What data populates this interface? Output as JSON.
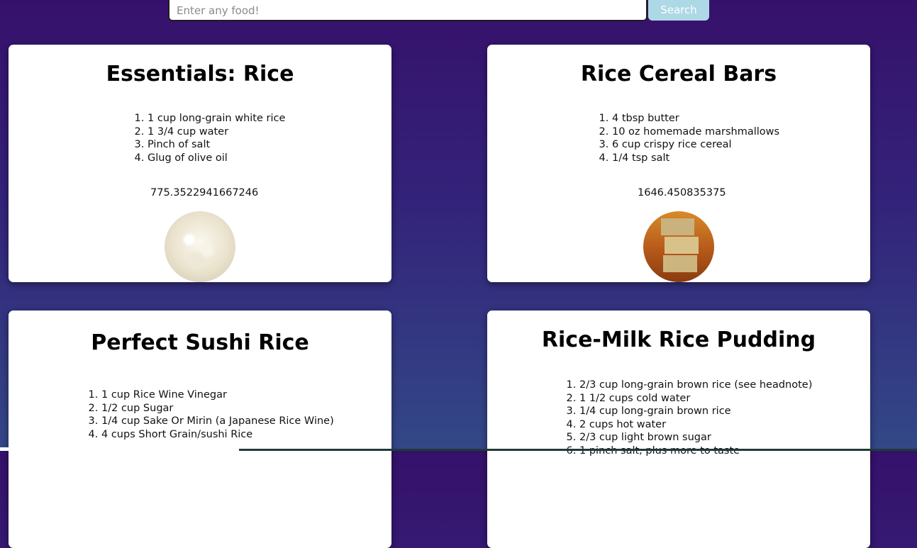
{
  "search": {
    "placeholder": "Enter any food!",
    "value": "",
    "button_label": "Search"
  },
  "recipes": [
    {
      "title": "Essentials: Rice",
      "ingredients": [
        "1 cup long-grain white rice",
        "1 3/4 cup water",
        "Pinch of salt",
        "Glug of olive oil"
      ],
      "calories": "775.3522941667246",
      "image": "rice-photo"
    },
    {
      "title": "Rice Cereal Bars",
      "ingredients": [
        "4 tbsp butter",
        "10 oz homemade marshmallows",
        "6 cup crispy rice cereal",
        "1/4 tsp salt"
      ],
      "calories": "1646.450835375",
      "image": "rice-cereal-bars-photo"
    },
    {
      "title": "Perfect Sushi Rice",
      "ingredients": [
        "1 cup Rice Wine Vinegar",
        "1/2 cup Sugar",
        "1/4 cup Sake Or Mirin (a Japanese Rice Wine)",
        "4 cups Short Grain/sushi Rice"
      ]
    },
    {
      "title": "Rice-Milk Rice Pudding",
      "ingredients": [
        "2/3 cup long-grain brown rice (see headnote)",
        "1 1/2 cups cold water",
        "1/4 cup long-grain brown rice",
        "2 cups hot water",
        "2/3 cup light brown sugar",
        "1 pinch salt, plus more to taste"
      ]
    }
  ],
  "colors": {
    "background_top": "#36116b",
    "background_bottom": "#334887",
    "search_button": "#add8e6"
  }
}
